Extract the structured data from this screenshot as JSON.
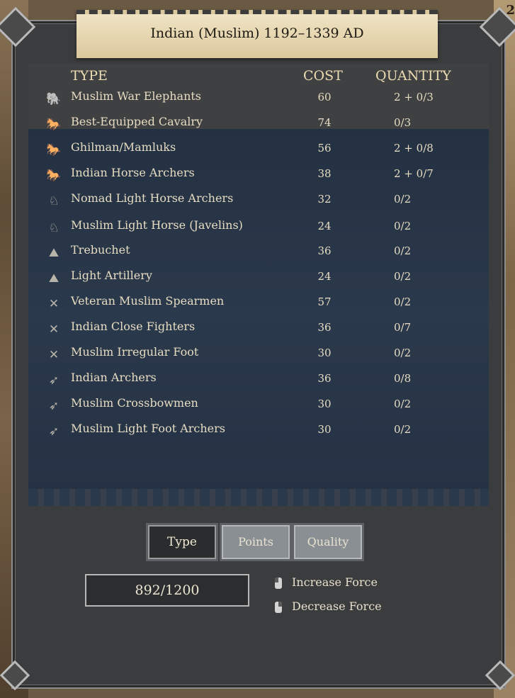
{
  "title": "Indian (Muslim) 1192–1339 AD",
  "corner_number": "2",
  "headers": {
    "type": "TYPE",
    "cost": "COST",
    "quantity": "QUANTITY"
  },
  "units": [
    {
      "icon": "elephant-icon",
      "glyph": "🐘",
      "name": "Muslim War Elephants",
      "cost": "60",
      "quantity": "2 + 0/3"
    },
    {
      "icon": "heavy-cavalry-icon",
      "glyph": "🐎",
      "name": "Best-Equipped Cavalry",
      "cost": "74",
      "quantity": "0/3"
    },
    {
      "icon": "heavy-cavalry-icon",
      "glyph": "🐎",
      "name": "Ghilman/Mamluks",
      "cost": "56",
      "quantity": "2 + 0/8"
    },
    {
      "icon": "heavy-cavalry-icon",
      "glyph": "🐎",
      "name": "Indian Horse Archers",
      "cost": "38",
      "quantity": "2 + 0/7"
    },
    {
      "icon": "light-cavalry-icon",
      "glyph": "♘",
      "name": "Nomad Light Horse Archers",
      "cost": "32",
      "quantity": "0/2"
    },
    {
      "icon": "light-cavalry-icon",
      "glyph": "♘",
      "name": "Muslim Light Horse (Javelins)",
      "cost": "24",
      "quantity": "0/2"
    },
    {
      "icon": "artillery-icon",
      "glyph": "⛰",
      "name": "Trebuchet",
      "cost": "36",
      "quantity": "0/2"
    },
    {
      "icon": "artillery-icon",
      "glyph": "⛰",
      "name": "Light Artillery",
      "cost": "24",
      "quantity": "0/2"
    },
    {
      "icon": "infantry-icon",
      "glyph": "✕",
      "name": "Veteran Muslim Spearmen",
      "cost": "57",
      "quantity": "0/2"
    },
    {
      "icon": "infantry-icon",
      "glyph": "✕",
      "name": "Indian Close Fighters",
      "cost": "36",
      "quantity": "0/7"
    },
    {
      "icon": "infantry-icon",
      "glyph": "✕",
      "name": "Muslim Irregular Foot",
      "cost": "30",
      "quantity": "0/2"
    },
    {
      "icon": "archer-icon",
      "glyph": "➶",
      "name": "Indian Archers",
      "cost": "36",
      "quantity": "0/8"
    },
    {
      "icon": "archer-icon",
      "glyph": "➶",
      "name": "Muslim Crossbowmen",
      "cost": "30",
      "quantity": "0/2"
    },
    {
      "icon": "archer-icon",
      "glyph": "➶",
      "name": "Muslim Light Foot Archers",
      "cost": "30",
      "quantity": "0/2"
    }
  ],
  "sort_buttons": {
    "type": "Type",
    "points": "Points",
    "quality": "Quality",
    "active": "Type"
  },
  "budget": "892/1200",
  "hints": {
    "increase": "Increase Force",
    "decrease": "Decrease Force"
  }
}
